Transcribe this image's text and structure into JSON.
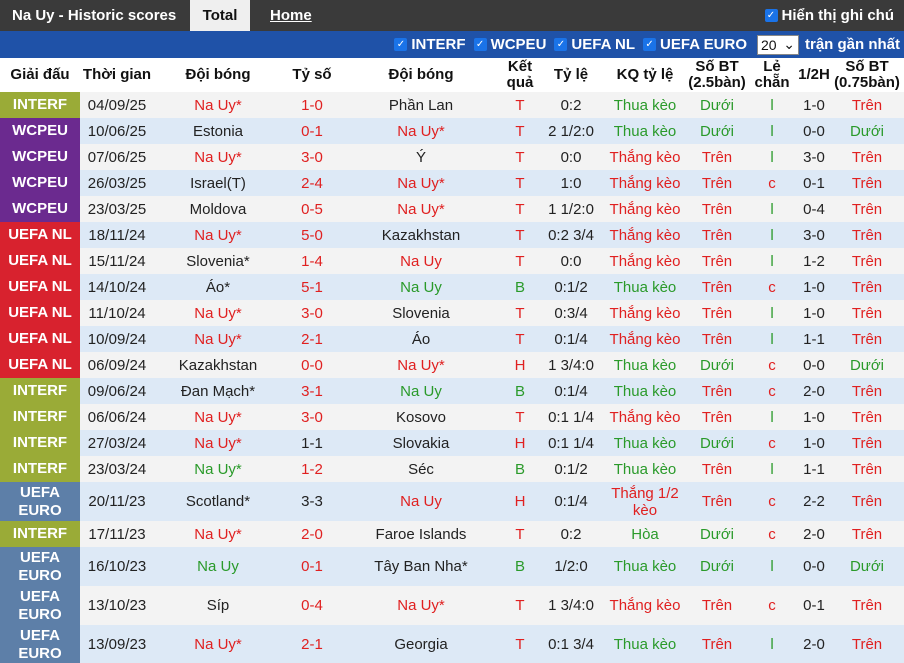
{
  "header": {
    "title": "Na Uy - Historic scores",
    "tab_total": "Total",
    "tab_home": "Home",
    "show_name": "Hiển thị ghi chú"
  },
  "filters": {
    "options": [
      "INTERF",
      "WCPEU",
      "UEFA NL",
      "UEFA EURO"
    ],
    "count": "20",
    "recent_label": "trận gần nhất"
  },
  "columns": [
    "Giải đấu",
    "Thời gian",
    "Đội bóng",
    "Tỷ số",
    "Đội bóng",
    "Kết quả",
    "Tỷ lệ",
    "KQ tỷ lệ",
    "Số BT (2.5bàn)",
    "Lẻ chẵn",
    "1/2H",
    "Số BT (0.75bàn)"
  ],
  "colors": {
    "INTERF": "#9aab37",
    "WCPEU": "#6b2a8f",
    "UEFA NL": "#d8222e",
    "UEFA EURO": "#5d7fa8",
    "red_text": "#e02020",
    "green_text": "#2a9a2a"
  },
  "rows": [
    {
      "league": "INTERF",
      "date": "04/09/25",
      "home": "Na Uy*",
      "score": "1-0",
      "away": "Phần Lan",
      "result": "T",
      "odds": "0:2",
      "odds_result": "Thua kèo",
      "ou": "Dưới",
      "oe": "l",
      "half": "1-0",
      "ou2": "Trên",
      "hc": "red",
      "sc": "red",
      "ac": "dark",
      "rc": "red",
      "orc": "green",
      "ouc": "green",
      "oec": "green",
      "o2c": "red"
    },
    {
      "league": "WCPEU",
      "date": "10/06/25",
      "home": "Estonia",
      "score": "0-1",
      "away": "Na Uy*",
      "result": "T",
      "odds": "2 1/2:0",
      "odds_result": "Thua kèo",
      "ou": "Dưới",
      "oe": "l",
      "half": "0-0",
      "ou2": "Dưới",
      "hc": "dark",
      "sc": "red",
      "ac": "red",
      "rc": "red",
      "orc": "green",
      "ouc": "green",
      "oec": "green",
      "o2c": "green"
    },
    {
      "league": "WCPEU",
      "date": "07/06/25",
      "home": "Na Uy*",
      "score": "3-0",
      "away": "Ý",
      "result": "T",
      "odds": "0:0",
      "odds_result": "Thắng kèo",
      "ou": "Trên",
      "oe": "l",
      "half": "3-0",
      "ou2": "Trên",
      "hc": "red",
      "sc": "red",
      "ac": "dark",
      "rc": "red",
      "orc": "red",
      "ouc": "red",
      "oec": "green",
      "o2c": "red"
    },
    {
      "league": "WCPEU",
      "date": "26/03/25",
      "home": "Israel(T)",
      "score": "2-4",
      "away": "Na Uy*",
      "result": "T",
      "odds": "1:0",
      "odds_result": "Thắng kèo",
      "ou": "Trên",
      "oe": "c",
      "half": "0-1",
      "ou2": "Trên",
      "hc": "dark",
      "sc": "red",
      "ac": "red",
      "rc": "red",
      "orc": "red",
      "ouc": "red",
      "oec": "red",
      "o2c": "red"
    },
    {
      "league": "WCPEU",
      "date": "23/03/25",
      "home": "Moldova",
      "score": "0-5",
      "away": "Na Uy*",
      "result": "T",
      "odds": "1 1/2:0",
      "odds_result": "Thắng kèo",
      "ou": "Trên",
      "oe": "l",
      "half": "0-4",
      "ou2": "Trên",
      "hc": "dark",
      "sc": "red",
      "ac": "red",
      "rc": "red",
      "orc": "red",
      "ouc": "red",
      "oec": "green",
      "o2c": "red"
    },
    {
      "league": "UEFA NL",
      "date": "18/11/24",
      "home": "Na Uy*",
      "score": "5-0",
      "away": "Kazakhstan",
      "result": "T",
      "odds": "0:2 3/4",
      "odds_result": "Thắng kèo",
      "ou": "Trên",
      "oe": "l",
      "half": "3-0",
      "ou2": "Trên",
      "hc": "red",
      "sc": "red",
      "ac": "dark",
      "rc": "red",
      "orc": "red",
      "ouc": "red",
      "oec": "green",
      "o2c": "red"
    },
    {
      "league": "UEFA NL",
      "date": "15/11/24",
      "home": "Slovenia*",
      "score": "1-4",
      "away": "Na Uy",
      "result": "T",
      "odds": "0:0",
      "odds_result": "Thắng kèo",
      "ou": "Trên",
      "oe": "l",
      "half": "1-2",
      "ou2": "Trên",
      "hc": "dark",
      "sc": "red",
      "ac": "red",
      "rc": "red",
      "orc": "red",
      "ouc": "red",
      "oec": "green",
      "o2c": "red"
    },
    {
      "league": "UEFA NL",
      "date": "14/10/24",
      "home": "Áo*",
      "score": "5-1",
      "away": "Na Uy",
      "result": "B",
      "odds": "0:1/2",
      "odds_result": "Thua kèo",
      "ou": "Trên",
      "oe": "c",
      "half": "1-0",
      "ou2": "Trên",
      "hc": "dark",
      "sc": "red",
      "ac": "green",
      "rc": "green",
      "orc": "green",
      "ouc": "red",
      "oec": "red",
      "o2c": "red"
    },
    {
      "league": "UEFA NL",
      "date": "11/10/24",
      "home": "Na Uy*",
      "score": "3-0",
      "away": "Slovenia",
      "result": "T",
      "odds": "0:3/4",
      "odds_result": "Thắng kèo",
      "ou": "Trên",
      "oe": "l",
      "half": "1-0",
      "ou2": "Trên",
      "hc": "red",
      "sc": "red",
      "ac": "dark",
      "rc": "red",
      "orc": "red",
      "ouc": "red",
      "oec": "green",
      "o2c": "red"
    },
    {
      "league": "UEFA NL",
      "date": "10/09/24",
      "home": "Na Uy*",
      "score": "2-1",
      "away": "Áo",
      "result": "T",
      "odds": "0:1/4",
      "odds_result": "Thắng kèo",
      "ou": "Trên",
      "oe": "l",
      "half": "1-1",
      "ou2": "Trên",
      "hc": "red",
      "sc": "red",
      "ac": "dark",
      "rc": "red",
      "orc": "red",
      "ouc": "red",
      "oec": "green",
      "o2c": "red"
    },
    {
      "league": "UEFA NL",
      "date": "06/09/24",
      "home": "Kazakhstan",
      "score": "0-0",
      "away": "Na Uy*",
      "result": "H",
      "odds": "1 3/4:0",
      "odds_result": "Thua kèo",
      "ou": "Dưới",
      "oe": "c",
      "half": "0-0",
      "ou2": "Dưới",
      "hc": "dark",
      "sc": "red",
      "ac": "red",
      "rc": "red",
      "orc": "green",
      "ouc": "green",
      "oec": "red",
      "o2c": "green"
    },
    {
      "league": "INTERF",
      "date": "09/06/24",
      "home": "Đan Mạch*",
      "score": "3-1",
      "away": "Na Uy",
      "result": "B",
      "odds": "0:1/4",
      "odds_result": "Thua kèo",
      "ou": "Trên",
      "oe": "c",
      "half": "2-0",
      "ou2": "Trên",
      "hc": "dark",
      "sc": "red",
      "ac": "green",
      "rc": "green",
      "orc": "green",
      "ouc": "red",
      "oec": "red",
      "o2c": "red"
    },
    {
      "league": "INTERF",
      "date": "06/06/24",
      "home": "Na Uy*",
      "score": "3-0",
      "away": "Kosovo",
      "result": "T",
      "odds": "0:1 1/4",
      "odds_result": "Thắng kèo",
      "ou": "Trên",
      "oe": "l",
      "half": "1-0",
      "ou2": "Trên",
      "hc": "red",
      "sc": "red",
      "ac": "dark",
      "rc": "red",
      "orc": "red",
      "ouc": "red",
      "oec": "green",
      "o2c": "red"
    },
    {
      "league": "INTERF",
      "date": "27/03/24",
      "home": "Na Uy*",
      "score": "1-1",
      "away": "Slovakia",
      "result": "H",
      "odds": "0:1 1/4",
      "odds_result": "Thua kèo",
      "ou": "Dưới",
      "oe": "c",
      "half": "1-0",
      "ou2": "Trên",
      "hc": "red",
      "sc": "dark",
      "ac": "dark",
      "rc": "red",
      "orc": "green",
      "ouc": "green",
      "oec": "red",
      "o2c": "red"
    },
    {
      "league": "INTERF",
      "date": "23/03/24",
      "home": "Na Uy*",
      "score": "1-2",
      "away": "Séc",
      "result": "B",
      "odds": "0:1/2",
      "odds_result": "Thua kèo",
      "ou": "Trên",
      "oe": "l",
      "half": "1-1",
      "ou2": "Trên",
      "hc": "green",
      "sc": "red",
      "ac": "dark",
      "rc": "green",
      "orc": "green",
      "ouc": "red",
      "oec": "green",
      "o2c": "red"
    },
    {
      "league": "UEFA EURO",
      "date": "20/11/23",
      "home": "Scotland*",
      "score": "3-3",
      "away": "Na Uy",
      "result": "H",
      "odds": "0:1/4",
      "odds_result": "Thắng 1/2 kèo",
      "ou": "Trên",
      "oe": "c",
      "half": "2-2",
      "ou2": "Trên",
      "hc": "dark",
      "sc": "dark",
      "ac": "red",
      "rc": "red",
      "orc": "red",
      "ouc": "red",
      "oec": "red",
      "o2c": "red",
      "tall": true
    },
    {
      "league": "INTERF",
      "date": "17/11/23",
      "home": "Na Uy*",
      "score": "2-0",
      "away": "Faroe Islands",
      "result": "T",
      "odds": "0:2",
      "odds_result": "Hòa",
      "ou": "Dưới",
      "oe": "c",
      "half": "2-0",
      "ou2": "Trên",
      "hc": "red",
      "sc": "red",
      "ac": "dark",
      "rc": "red",
      "orc": "green",
      "ouc": "green",
      "oec": "red",
      "o2c": "red"
    },
    {
      "league": "UEFA EURO",
      "date": "16/10/23",
      "home": "Na Uy",
      "score": "0-1",
      "away": "Tây Ban Nha*",
      "result": "B",
      "odds": "1/2:0",
      "odds_result": "Thua kèo",
      "ou": "Dưới",
      "oe": "l",
      "half": "0-0",
      "ou2": "Dưới",
      "hc": "green",
      "sc": "red",
      "ac": "dark",
      "rc": "green",
      "orc": "green",
      "ouc": "green",
      "oec": "green",
      "o2c": "green",
      "tall": true
    },
    {
      "league": "UEFA EURO",
      "date": "13/10/23",
      "home": "Síp",
      "score": "0-4",
      "away": "Na Uy*",
      "result": "T",
      "odds": "1 3/4:0",
      "odds_result": "Thắng kèo",
      "ou": "Trên",
      "oe": "c",
      "half": "0-1",
      "ou2": "Trên",
      "hc": "dark",
      "sc": "red",
      "ac": "red",
      "rc": "red",
      "orc": "red",
      "ouc": "red",
      "oec": "red",
      "o2c": "red",
      "tall": true
    },
    {
      "league": "UEFA EURO",
      "date": "13/09/23",
      "home": "Na Uy*",
      "score": "2-1",
      "away": "Georgia",
      "result": "T",
      "odds": "0:1 3/4",
      "odds_result": "Thua kèo",
      "ou": "Trên",
      "oe": "l",
      "half": "2-0",
      "ou2": "Trên",
      "hc": "red",
      "sc": "red",
      "ac": "dark",
      "rc": "red",
      "orc": "green",
      "ouc": "red",
      "oec": "green",
      "o2c": "red",
      "tall": true
    }
  ]
}
